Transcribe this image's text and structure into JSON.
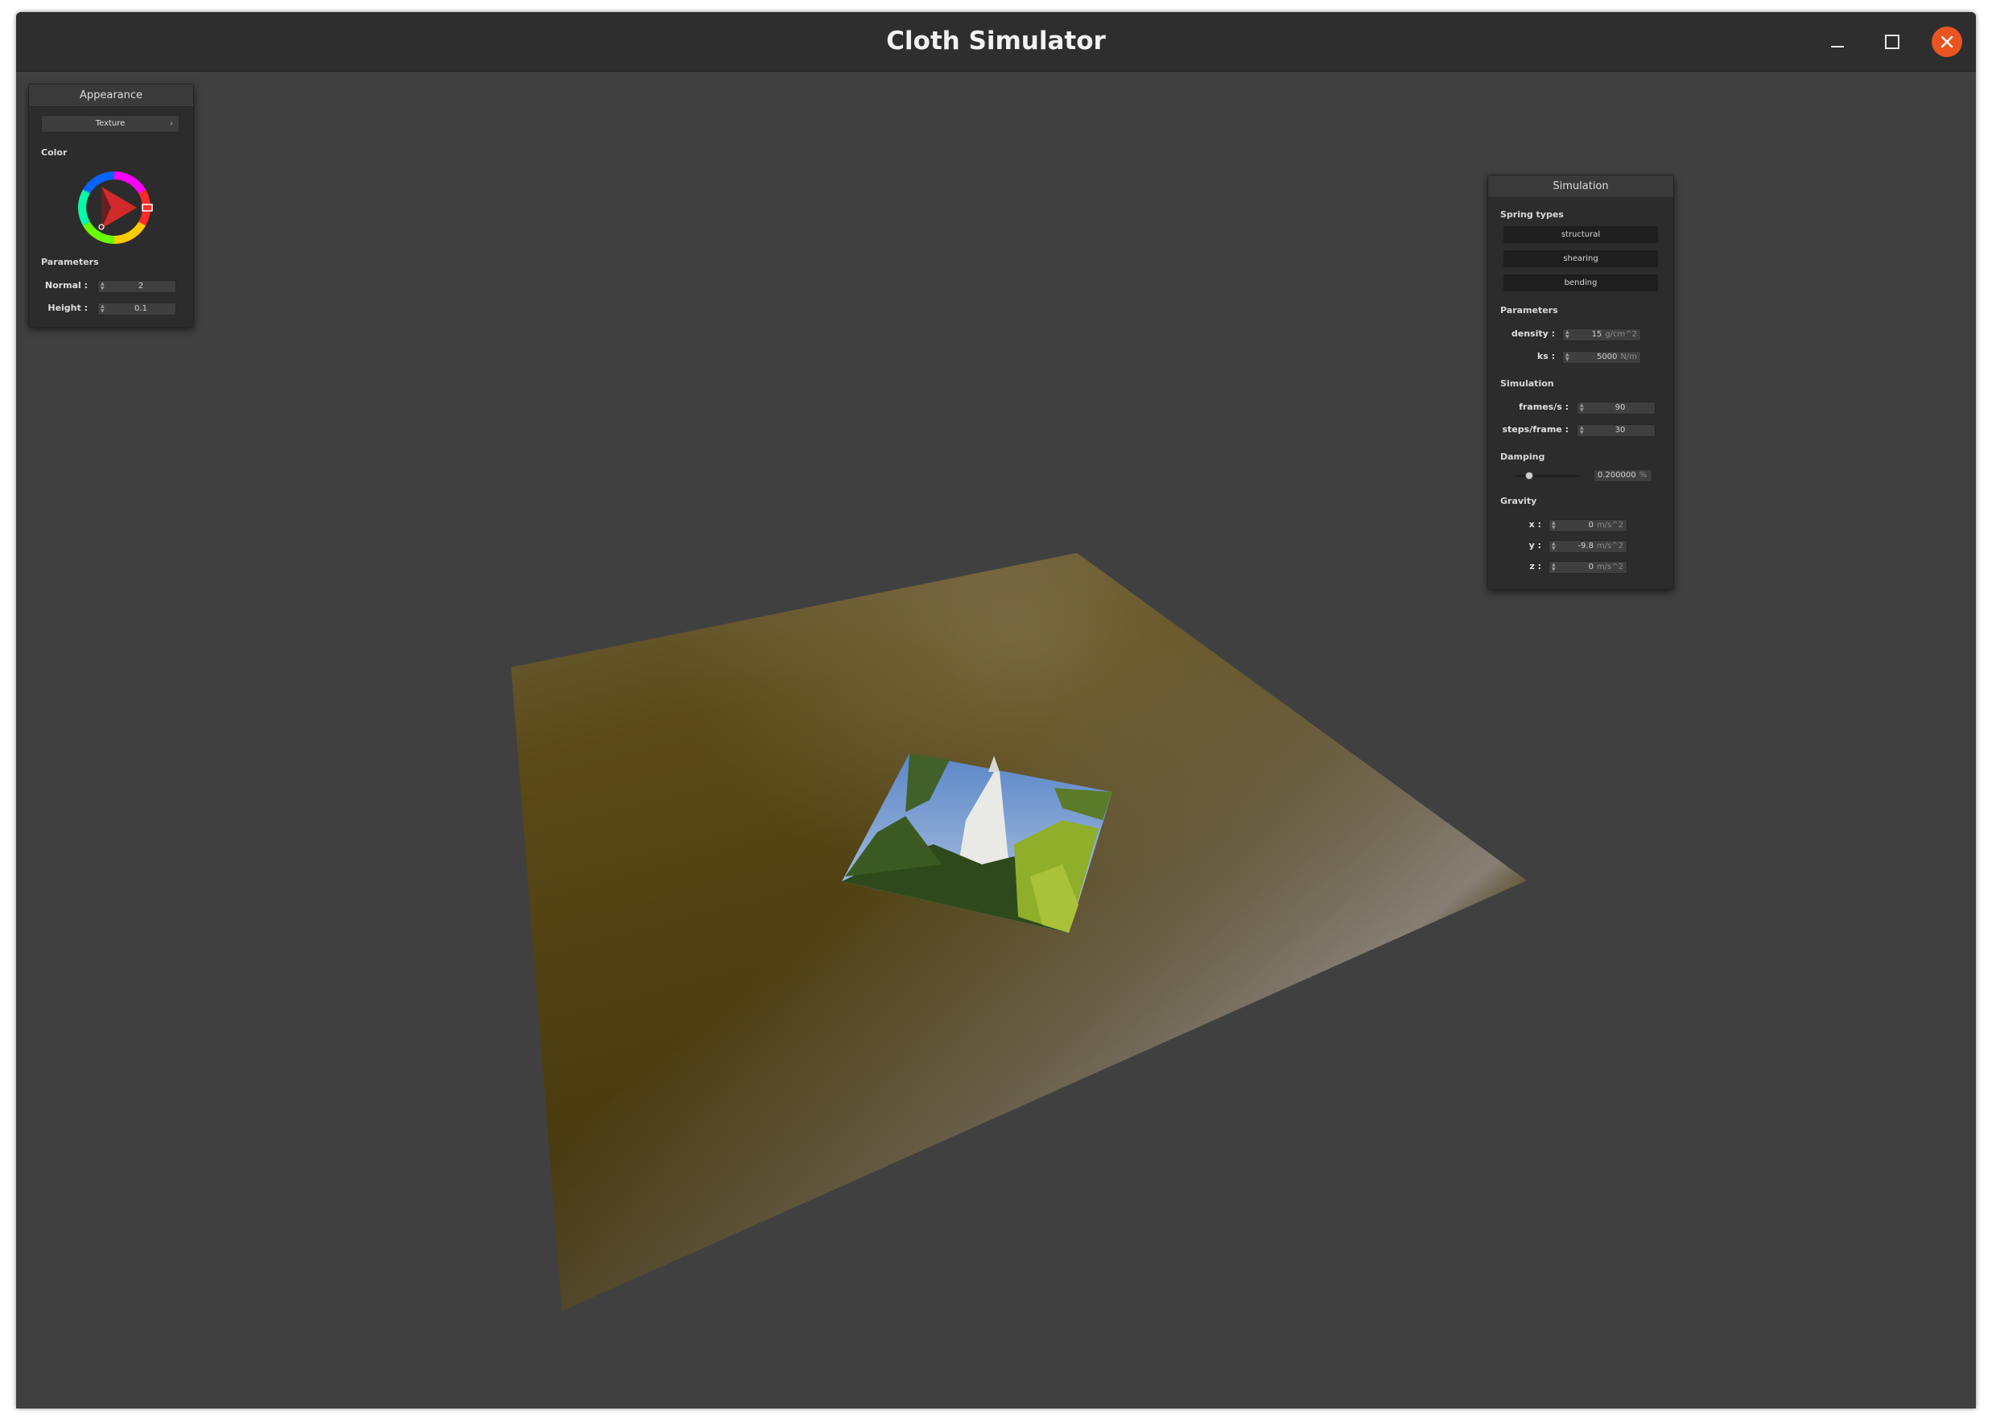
{
  "window": {
    "title": "Cloth Simulator"
  },
  "appearance": {
    "title": "Appearance",
    "shader": "Texture",
    "color_label": "Color",
    "params_label": "Parameters",
    "normal_label": "Normal :",
    "normal_value": "2",
    "height_label": "Height :",
    "height_value": "0.1",
    "picked_color": "#ff3030"
  },
  "simulation": {
    "title": "Simulation",
    "spring_types_label": "Spring types",
    "spring_types": [
      "structural",
      "shearing",
      "bending"
    ],
    "params_label": "Parameters",
    "density_label": "density :",
    "density_value": "15",
    "density_unit": "g/cm^2",
    "ks_label": "ks :",
    "ks_value": "5000",
    "ks_unit": "N/m",
    "sim_label": "Simulation",
    "fps_label": "frames/s :",
    "fps_value": "90",
    "steps_label": "steps/frame :",
    "steps_value": "30",
    "damping_label": "Damping",
    "damping_value": "0.200000",
    "damping_unit": "%",
    "damping_level": 0.2,
    "gravity_label": "Gravity",
    "gx_label": "x :",
    "gx_value": "0",
    "gy_label": "y :",
    "gy_value": "-9.8",
    "gz_label": "z :",
    "gz_value": "0",
    "gravity_unit": "m/s^2"
  },
  "colors": {
    "close_button": "#e95420",
    "cloth": "#5a4710",
    "background": "#404040"
  }
}
